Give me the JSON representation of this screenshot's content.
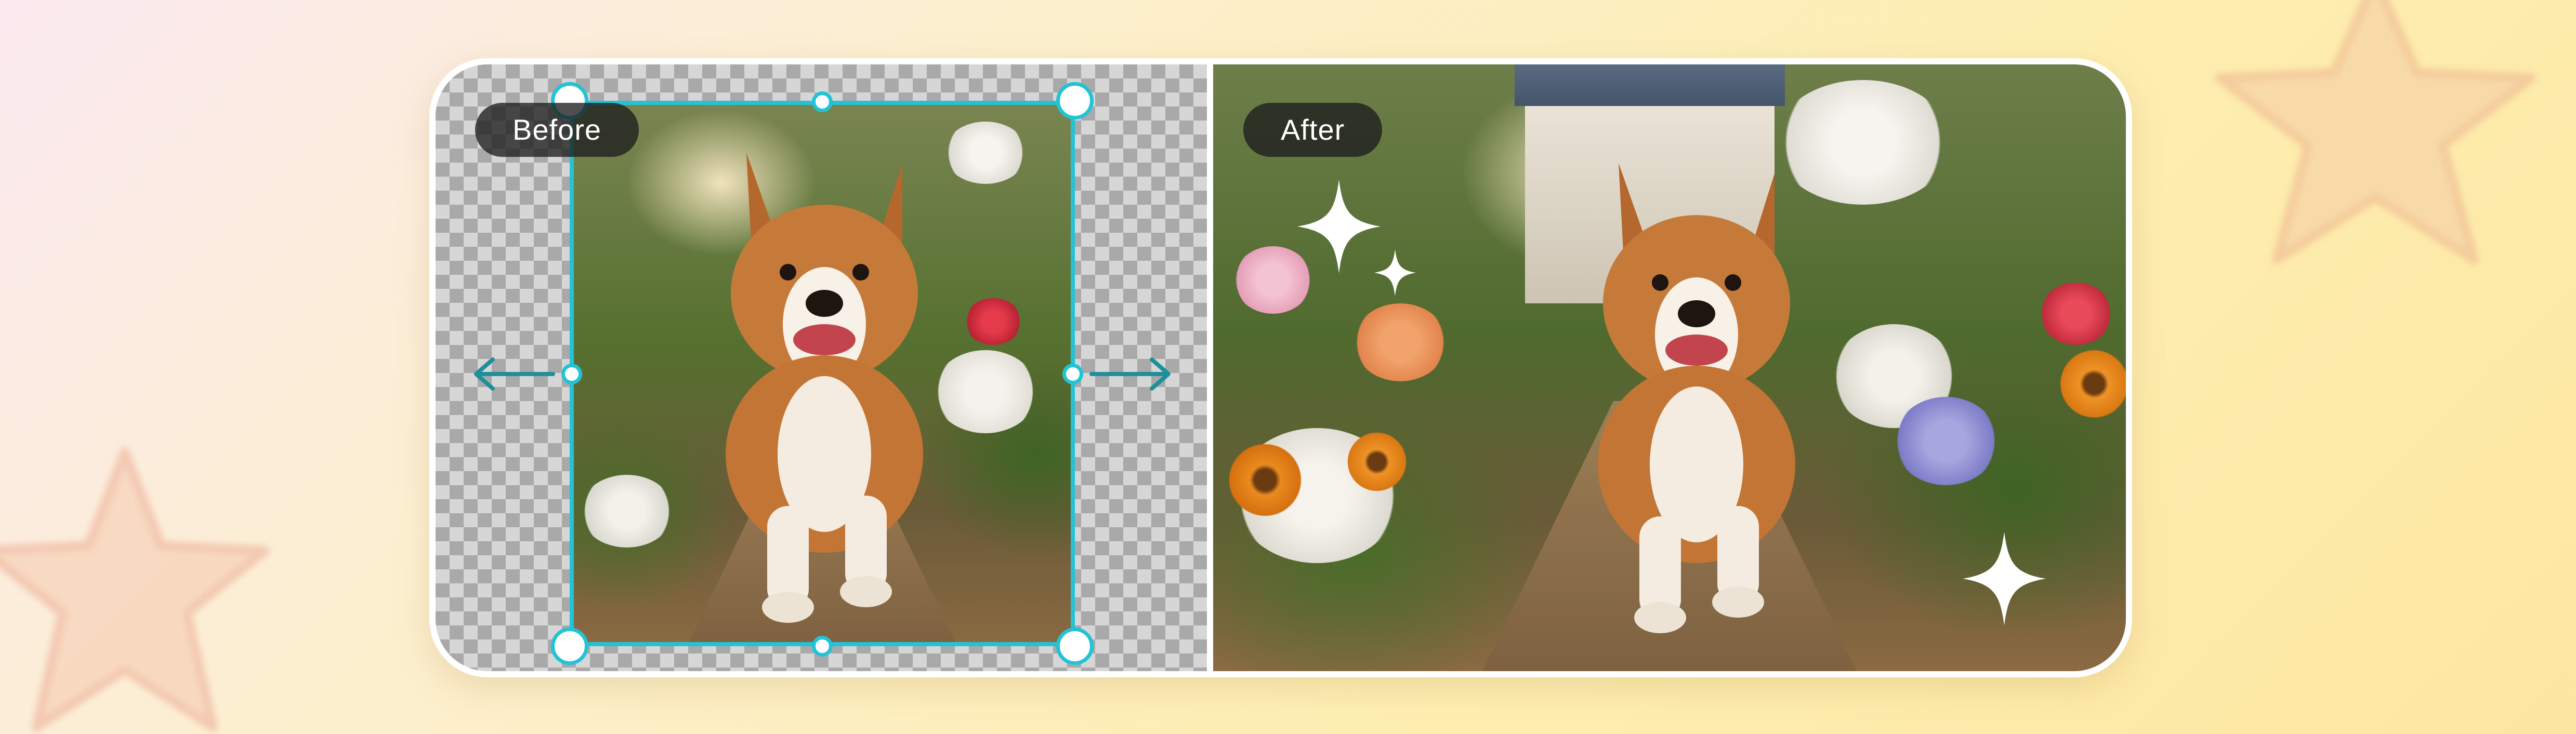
{
  "labels": {
    "before": "Before",
    "after": "After"
  },
  "colors": {
    "crop_accent": "#22c3d6",
    "arrow": "#1f8f99",
    "badge_bg": "#1e1e1e",
    "card_bg": "#ffffff"
  },
  "icons": {
    "sparkle": "sparkle-icon",
    "arrow_left": "arrow-left-icon",
    "arrow_right": "arrow-right-icon",
    "bg_star": "star-icon"
  }
}
